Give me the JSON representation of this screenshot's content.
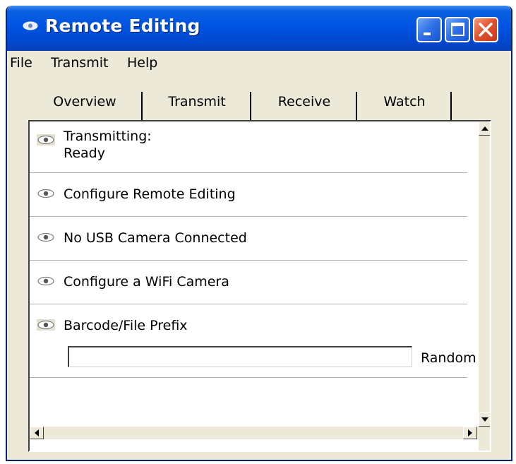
{
  "window": {
    "title": "Remote Editing",
    "colors": {
      "titlebar": "#0054e3",
      "close": "#e0502c",
      "face": "#ece9d8"
    }
  },
  "menu": {
    "items": [
      "File",
      "Transmit",
      "Help"
    ]
  },
  "tabs": [
    "Overview",
    "Transmit",
    "Receive",
    "Watch"
  ],
  "rows": [
    {
      "line1": "Transmitting:",
      "line2": "Ready",
      "icon": "eye-icon"
    },
    {
      "label": "Configure Remote Editing",
      "icon": "eye-icon"
    },
    {
      "label": "No USB Camera Connected",
      "icon": "eye-icon"
    },
    {
      "label": "Configure a WiFi Camera",
      "icon": "eye-icon"
    },
    {
      "label": "Barcode/File Prefix",
      "icon": "eye-icon"
    }
  ],
  "prefix": {
    "value": "",
    "random_label": "Random"
  }
}
